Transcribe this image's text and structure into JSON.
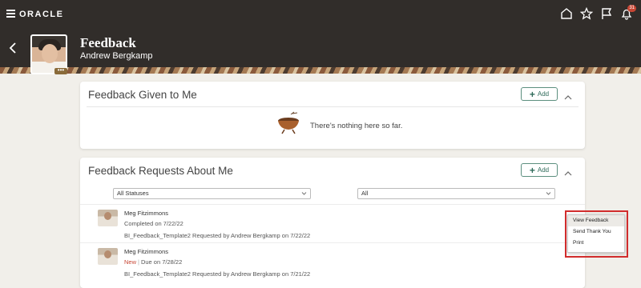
{
  "topbar": {
    "logo": "ORACLE",
    "notification_count": "31",
    "icons": [
      "menu-icon",
      "home-icon",
      "star-icon",
      "flag-icon",
      "bell-icon"
    ]
  },
  "header": {
    "title": "Feedback",
    "subtitle": "Andrew Bergkamp",
    "avatar_more": "•••"
  },
  "card_given": {
    "title": "Feedback Given to Me",
    "add_label": "Add",
    "empty_text": "There's nothing here so far."
  },
  "card_requests": {
    "title": "Feedback Requests About Me",
    "add_label": "Add",
    "status_filter": "All Statuses",
    "type_filter": "All",
    "rows": [
      {
        "name": "Meg Fitzimmons",
        "status": "Completed on 7/22/22",
        "desc": "BI_Feedback_Template2 Requested by Andrew Bergkamp on 7/22/22",
        "more": "..."
      },
      {
        "name": "Meg Fitzimmons",
        "status_new": "New",
        "status_due": "Due on 7/28/22",
        "desc": "BI_Feedback_Template2 Requested by Andrew Bergkamp on 7/21/22"
      }
    ]
  },
  "context_menu": {
    "items": [
      "View Feedback",
      "Send Thank You",
      "Print"
    ]
  },
  "colors": {
    "topbar": "#312d2a",
    "accent_green": "#2f6b5a",
    "new_status": "#c74634",
    "highlight_border": "#d12c2c"
  }
}
